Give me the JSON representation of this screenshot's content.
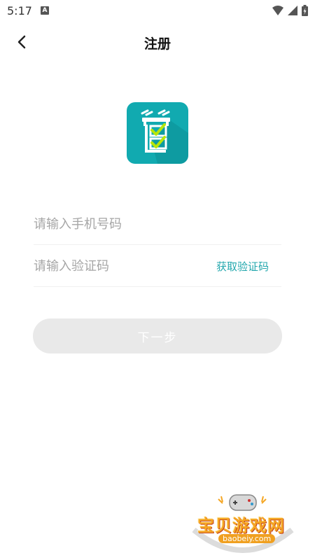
{
  "status_bar": {
    "time": "5:17",
    "notification_badge": "A"
  },
  "header": {
    "title": "注册"
  },
  "form": {
    "phone_placeholder": "请输入手机号码",
    "code_placeholder": "请输入验证码",
    "get_code_label": "获取验证码",
    "next_label": "下一步"
  },
  "watermark": {
    "title": "宝贝游戏网",
    "url": "baobeiy.com"
  },
  "colors": {
    "brand": "#11aab0",
    "link": "#23a7ad",
    "button_disabled": "#e9e9e9"
  }
}
